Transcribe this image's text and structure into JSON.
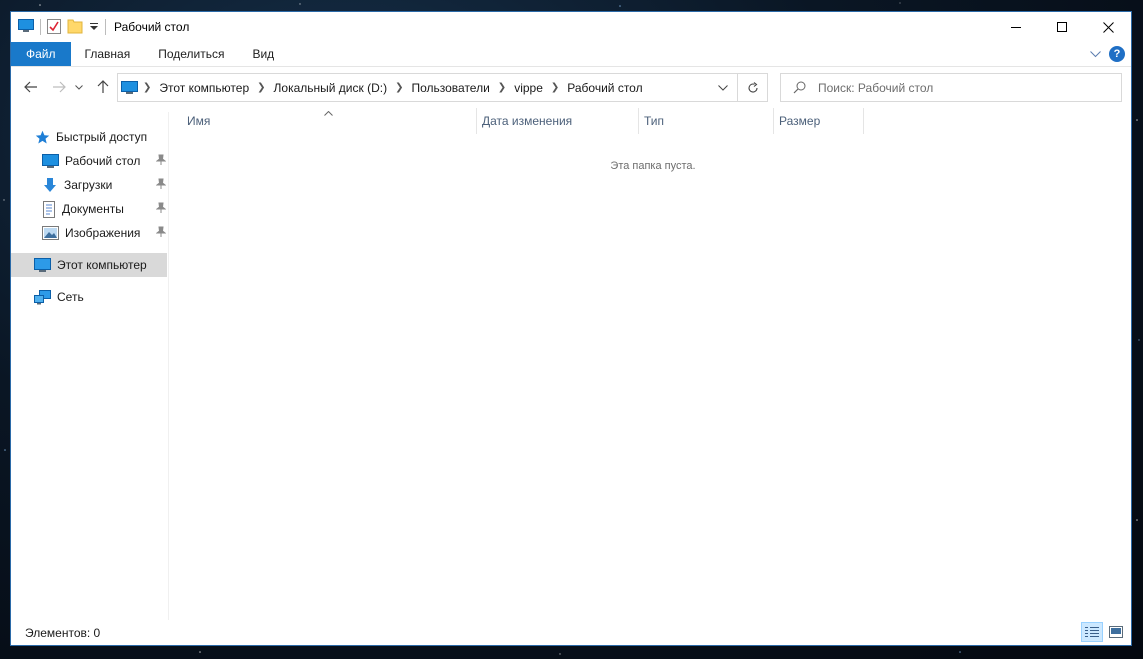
{
  "window": {
    "title": "Рабочий стол",
    "controls": {
      "minimize_icon": "minimize-icon",
      "maximize_icon": "maximize-icon",
      "close_icon": "close-icon"
    }
  },
  "ribbon": {
    "tabs": [
      {
        "label": "Файл",
        "active": true
      },
      {
        "label": "Главная"
      },
      {
        "label": "Поделиться"
      },
      {
        "label": "Вид"
      }
    ],
    "file_color": "#1979ca"
  },
  "address_bar": {
    "crumbs": [
      "Этот компьютер",
      "Локальный диск (D:)",
      "Пользователи",
      "vippe",
      "Рабочий стол"
    ]
  },
  "search": {
    "placeholder": "Поиск: Рабочий стол"
  },
  "sidebar": {
    "items": [
      {
        "label": "Быстрый доступ",
        "icon": "star-icon"
      },
      {
        "label": "Рабочий стол",
        "icon": "desktop-icon",
        "pinned": true
      },
      {
        "label": "Загрузки",
        "icon": "download-icon",
        "pinned": true
      },
      {
        "label": "Документы",
        "icon": "document-icon",
        "pinned": true
      },
      {
        "label": "Изображения",
        "icon": "pictures-icon",
        "pinned": true
      },
      {
        "label": "Этот компьютер",
        "icon": "computer-icon",
        "selected": true
      },
      {
        "label": "Сеть",
        "icon": "network-icon"
      }
    ]
  },
  "columns": [
    "Имя",
    "Дата изменения",
    "Тип",
    "Размер"
  ],
  "empty_message": "Эта папка пуста.",
  "status": {
    "text": "Элементов: 0"
  }
}
